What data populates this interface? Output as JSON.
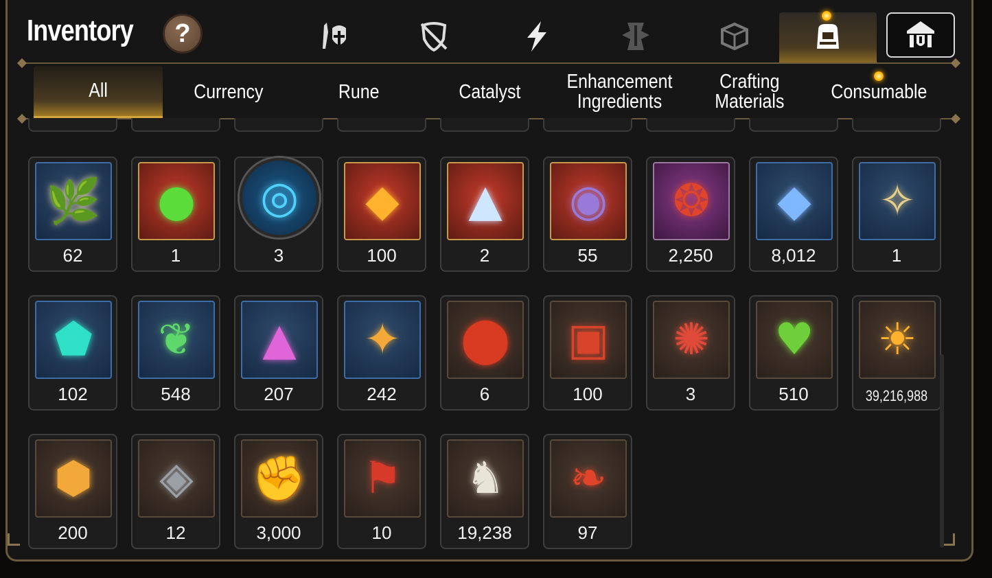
{
  "header": {
    "title": "Inventory",
    "help_label": "?",
    "category_icons": [
      "gear-knight-icon",
      "shield-broken-icon",
      "lightning-icon",
      "artifact-icon",
      "cube-icon",
      "backpack-icon"
    ],
    "active_category": "backpack-icon",
    "guild_icon": "guild-icon"
  },
  "subtabs": [
    {
      "label": "All",
      "active": true
    },
    {
      "label": "Currency",
      "active": false
    },
    {
      "label": "Rune",
      "active": false
    },
    {
      "label": "Catalyst",
      "active": false
    },
    {
      "label": "Enhancement\nIngredients",
      "active": false
    },
    {
      "label": "Crafting\nMaterials",
      "active": false
    },
    {
      "label": "Consumable",
      "active": false
    }
  ],
  "items": [
    {
      "icon": "ginseng-root-icon",
      "frame": "blue",
      "qty": "62"
    },
    {
      "icon": "green-orb-icon",
      "frame": "red",
      "qty": "1"
    },
    {
      "icon": "blue-rune-disc-icon",
      "frame": "round",
      "qty": "3"
    },
    {
      "icon": "gold-crystal-icon",
      "frame": "red",
      "qty": "100"
    },
    {
      "icon": "triangle-gem-icon",
      "frame": "red",
      "qty": "2"
    },
    {
      "icon": "dark-pendant-icon",
      "frame": "red",
      "qty": "55"
    },
    {
      "icon": "red-ring-icon",
      "frame": "purple",
      "qty": "2,250"
    },
    {
      "icon": "blue-crystal-icon",
      "frame": "blue",
      "qty": "8,012"
    },
    {
      "icon": "golden-pendant-icon",
      "frame": "blue",
      "qty": "1"
    },
    {
      "icon": "teal-crystal-icon",
      "frame": "blue",
      "qty": "102"
    },
    {
      "icon": "green-leaf-icon",
      "frame": "blue",
      "qty": "548"
    },
    {
      "icon": "pink-crystal-icon",
      "frame": "blue",
      "qty": "207"
    },
    {
      "icon": "star-compass-icon",
      "frame": "blue",
      "qty": "242"
    },
    {
      "icon": "fire-orb-icon",
      "frame": "brown",
      "qty": "6"
    },
    {
      "icon": "red-bracelet-icon",
      "frame": "brown",
      "qty": "100"
    },
    {
      "icon": "red-seal-icon",
      "frame": "brown",
      "qty": "3"
    },
    {
      "icon": "green-heart-icon",
      "frame": "brown",
      "qty": "510"
    },
    {
      "icon": "gold-sun-coin-icon",
      "frame": "brown",
      "qty": "39,216,988"
    },
    {
      "icon": "gold-hex-emblem-icon",
      "frame": "brown",
      "qty": "200"
    },
    {
      "icon": "stone-compass-icon",
      "frame": "brown",
      "qty": "12"
    },
    {
      "icon": "fist-emblem-icon",
      "frame": "brown",
      "qty": "3,000"
    },
    {
      "icon": "red-banner-icon",
      "frame": "brown",
      "qty": "10"
    },
    {
      "icon": "white-knight-icon",
      "frame": "brown",
      "qty": "19,238"
    },
    {
      "icon": "red-leaf-icon",
      "frame": "brown",
      "qty": "97"
    }
  ],
  "colors": {
    "accent_gold": "#d4a63a",
    "frame_border": "#6b5a3d",
    "panel_bg": "#171616",
    "notification": "#ffb300"
  }
}
